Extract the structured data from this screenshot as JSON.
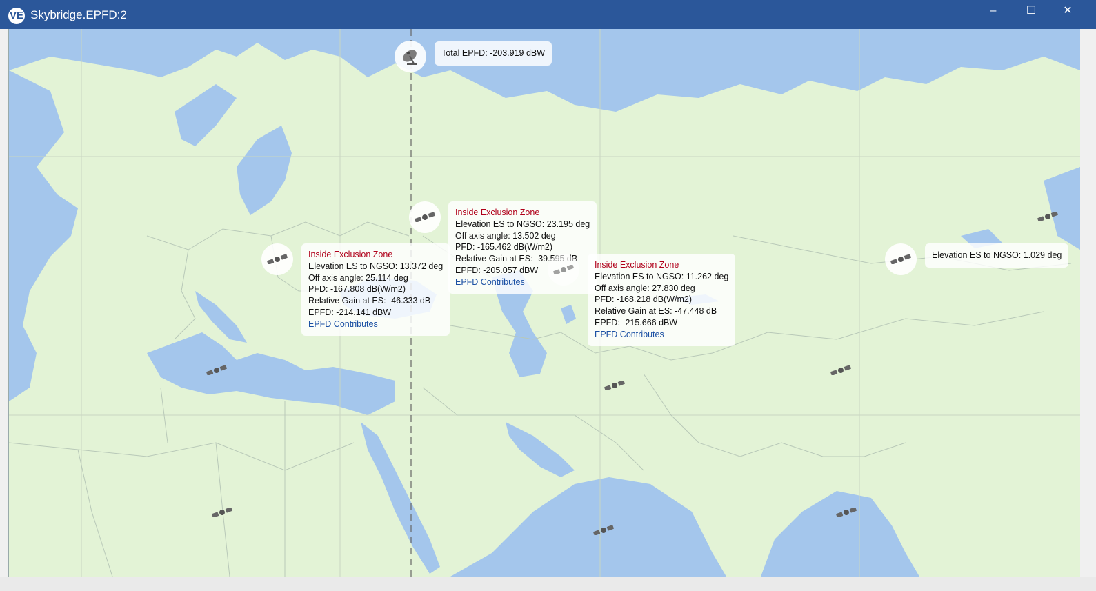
{
  "window": {
    "app_icon_glyph": "VE",
    "title": "Skybridge.EPFD:2",
    "minimize_glyph": "–",
    "maximize_glyph": "☐",
    "close_glyph": "✕"
  },
  "map": {
    "colors": {
      "land": "#e3f3d6",
      "water": "#a4c6ec",
      "border": "#b8c8b8",
      "grid": "#c9d6c2",
      "meridian": "#666666"
    },
    "total_epfd": {
      "text": "Total EPFD: -203.919 dBW",
      "icon": "satellite-dish-icon"
    },
    "callouts": [
      {
        "zone": "Inside Exclusion Zone",
        "elevation": "Elevation ES to NGSO: 13.372 deg",
        "off_axis": "Off axis angle: 25.114 deg",
        "pfd": "PFD: -167.808 dB(W/m2)",
        "gain": "Relative Gain at ES: -46.333 dB",
        "epfd": "EPFD: -214.141 dBW",
        "link": "EPFD Contributes"
      },
      {
        "zone": "Inside Exclusion Zone",
        "elevation": "Elevation ES to NGSO: 23.195 deg",
        "off_axis": "Off axis angle: 13.502 deg",
        "pfd": "PFD: -165.462 dB(W/m2)",
        "gain": "Relative Gain at ES: -39.595 dB",
        "epfd": "EPFD: -205.057 dBW",
        "link": "EPFD Contributes"
      },
      {
        "zone": "Inside Exclusion Zone",
        "elevation": "Elevation ES to NGSO: 11.262 deg",
        "off_axis": "Off axis angle: 27.830 deg",
        "pfd": "PFD: -168.218 dB(W/m2)",
        "gain": "Relative Gain at ES: -47.448 dB",
        "epfd": "EPFD: -215.666 dBW",
        "link": "EPFD Contributes"
      },
      {
        "elevation": "Elevation ES to NGSO: 1.029 deg"
      }
    ],
    "satellite_icon": "satellite-icon"
  }
}
